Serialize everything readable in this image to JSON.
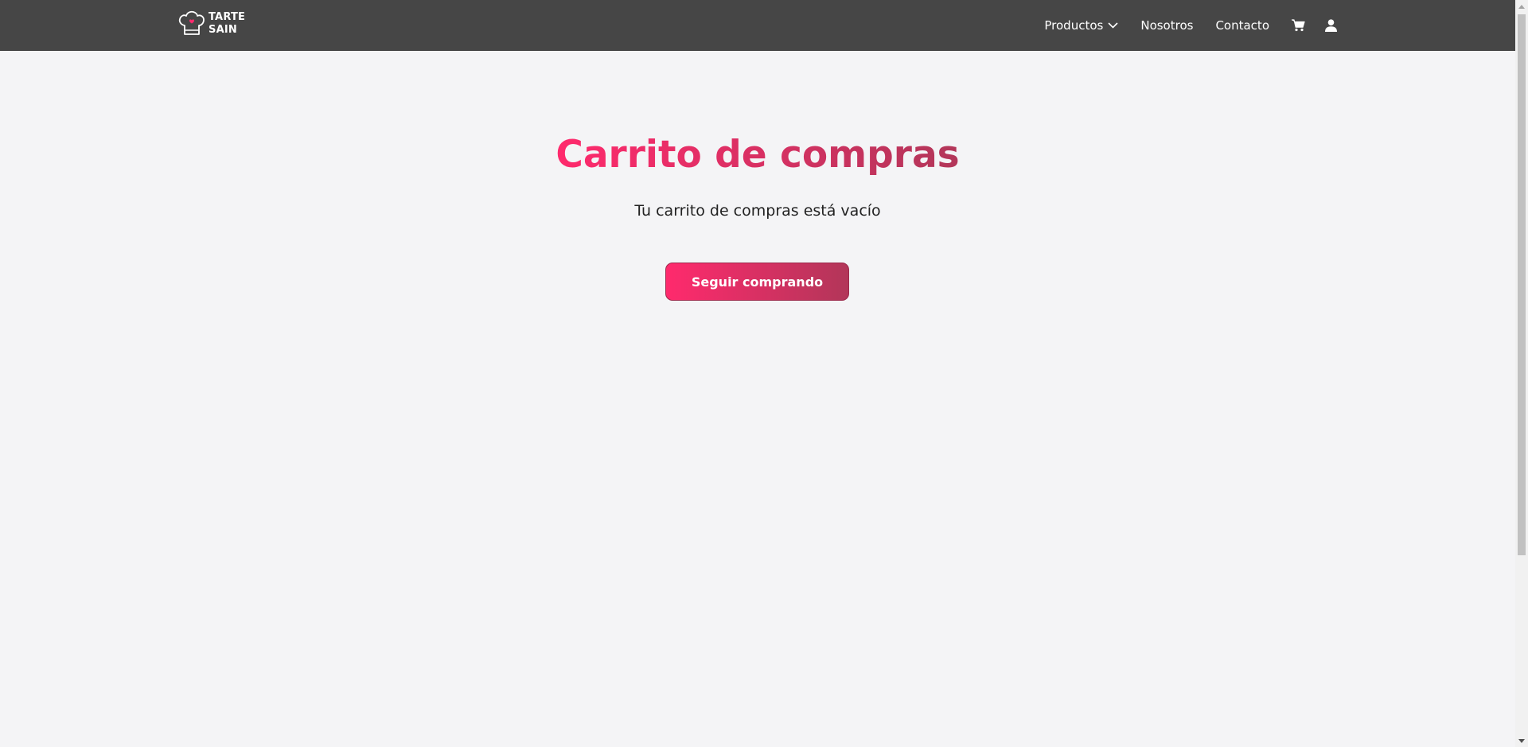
{
  "header": {
    "brand": {
      "line1": "TARTE",
      "line2": "SAIN",
      "logo_icon": "chef-hat-icon"
    },
    "nav": {
      "products_label": "Productos",
      "about_label": "Nosotros",
      "contact_label": "Contacto"
    },
    "icons": {
      "cart": "cart-icon",
      "user": "user-icon",
      "dropdown": "chevron-down-icon"
    }
  },
  "main": {
    "title": "Carrito de compras",
    "empty_message": "Tu carrito de compras está vacío",
    "continue_button_label": "Seguir comprando"
  },
  "colors": {
    "navbar": "#464646",
    "background": "#f4f4f6",
    "accent_start": "#ff2a6d",
    "accent_end": "#b23659"
  }
}
